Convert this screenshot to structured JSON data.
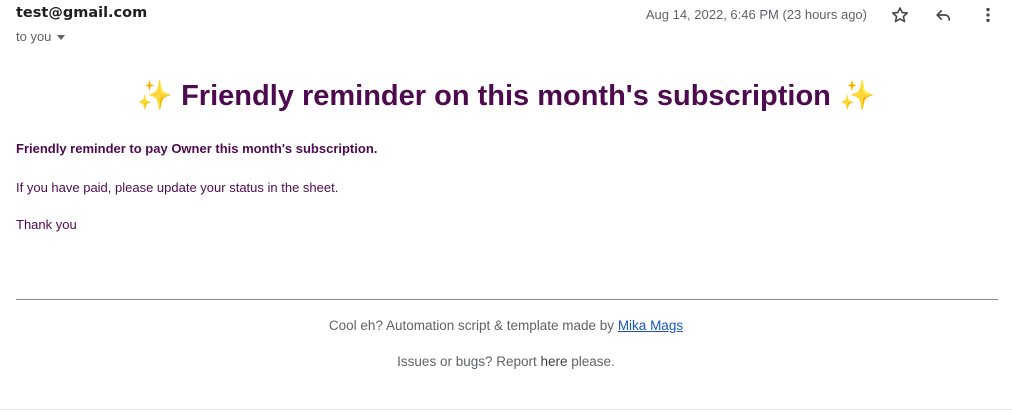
{
  "header": {
    "sender": "test@gmail.com",
    "recipient": "to you",
    "date": "Aug 14, 2022, 6:46 PM (23 hours ago)",
    "icons": [
      "star-icon",
      "reply-icon",
      "more-vert-icon"
    ]
  },
  "body": {
    "title": "Friendly reminder on this month's subscription",
    "title_emoji": "✨",
    "paragraph1": "Friendly reminder to pay Owner this month's subscription.",
    "paragraph2": "If you have paid, please update your status in the sheet.",
    "paragraph3": "Thank you"
  },
  "footer": {
    "line1_prefix": "Cool eh? Automation script & template made by ",
    "line1_link": "Mika Mags",
    "line2_prefix": "Issues or bugs? Report ",
    "line2_link": "here",
    "line2_suffix": " please."
  },
  "colors": {
    "accent": "#4e0a4f",
    "link": "#1a55c0",
    "muted": "#5f6368"
  }
}
